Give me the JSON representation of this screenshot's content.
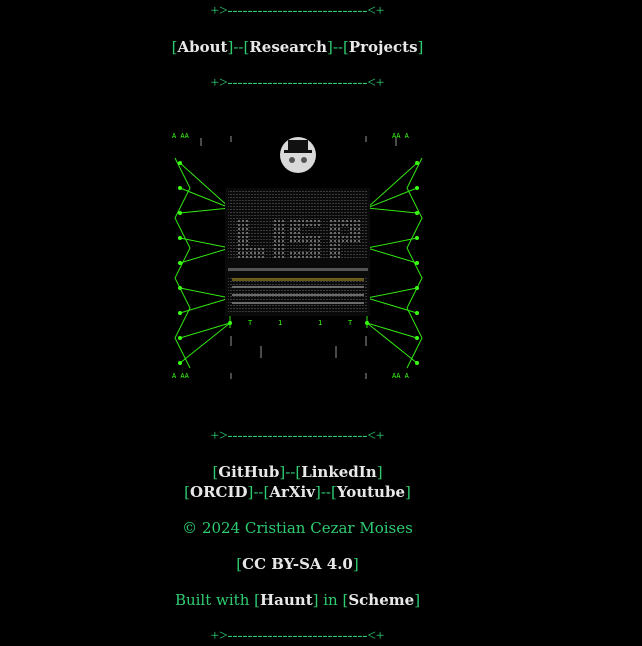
{
  "divider": "+>----------------------------<+",
  "nav": {
    "items": [
      {
        "label": "About"
      },
      {
        "label": "Research"
      },
      {
        "label": "Projects"
      }
    ],
    "separator": "--"
  },
  "banner": {
    "title": "LISP",
    "icon": "hat-mascot-icon"
  },
  "social": {
    "row1": [
      {
        "label": "GitHub"
      },
      {
        "label": "LinkedIn"
      }
    ],
    "row2": [
      {
        "label": "ORCID"
      },
      {
        "label": "ArXiv"
      },
      {
        "label": "Youtube"
      }
    ],
    "separator": "--"
  },
  "footer": {
    "copyright": "© 2024 Cristian Cezar Moises",
    "license": "CC BY-SA 4.0",
    "built_prefix": "Built with ",
    "built_tool": "Haunt",
    "built_mid": " in ",
    "built_lang": "Scheme"
  },
  "colors": {
    "accent": "#2ecc71",
    "link": "#e8e8e8",
    "background": "#000000"
  }
}
